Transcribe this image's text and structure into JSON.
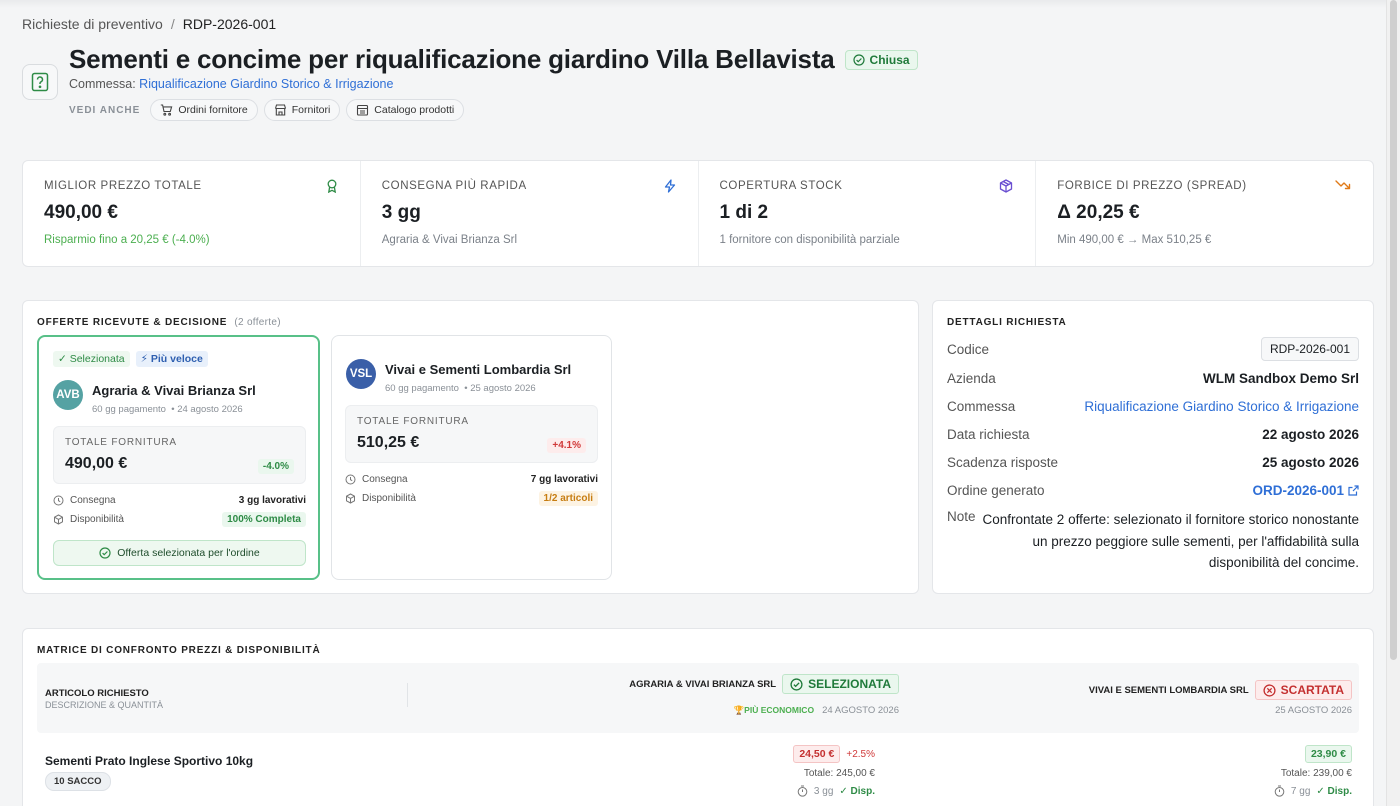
{
  "breadcrumb": {
    "parent": "Richieste di preventivo",
    "separator": "/",
    "current": "RDP-2026-001"
  },
  "header": {
    "title": "Sementi e concime per riqualificazione giardino Villa Bellavista",
    "status": "Chiusa",
    "commessa_label": "Commessa:",
    "commessa_value": "Riqualificazione Giardino Storico & Irrigazione",
    "see_also_label": "VEDI ANCHE",
    "links": [
      "Ordini fornitore",
      "Fornitori",
      "Catalogo prodotti"
    ]
  },
  "kpis": [
    {
      "label": "MIGLIOR PREZZO TOTALE",
      "value": "490,00 €",
      "sub": "Risparmio fino a 20,25 € (-4.0%)",
      "icon": "award-icon"
    },
    {
      "label": "CONSEGNA PIÙ RAPIDA",
      "value": "3 gg",
      "sub": "Agraria & Vivai Brianza Srl",
      "icon": "zap-icon"
    },
    {
      "label": "COPERTURA STOCK",
      "value": "1 di 2",
      "sub": "1 fornitore con disponibilità parziale",
      "icon": "package-icon"
    },
    {
      "label": "FORBICE DI PREZZO (SPREAD)",
      "value": "Δ 20,25 €",
      "sub": "Min 490,00 € → Max 510,25 €",
      "icon": "trending-down-icon"
    }
  ],
  "offers": {
    "title": "OFFERTE RICEVUTE & DECISIONE",
    "count": "(2 offerte)",
    "selected": {
      "tag_selected": "✓ Selezionata",
      "tag_fast": "⚡ Più veloce",
      "initials": "AVB",
      "name": "Agraria & Vivai Brianza Srl",
      "payment": "60 gg pagamento",
      "date": "• 24 agosto 2026",
      "total_label": "TOTALE FORNITURA",
      "total": "490,00 €",
      "delta": "-4.0%",
      "delivery_label": "Consegna",
      "delivery": "3 gg lavorativi",
      "availability_label": "Disponibilità",
      "availability": "100% Completa",
      "button": "Offerta selezionata per l'ordine"
    },
    "other": {
      "initials": "VSL",
      "name": "Vivai e Sementi Lombardia Srl",
      "payment": "60 gg pagamento",
      "date": "• 25 agosto 2026",
      "total_label": "TOTALE FORNITURA",
      "total": "510,25 €",
      "delta": "+4.1%",
      "delivery_label": "Consegna",
      "delivery": "7 gg lavorativi",
      "availability_label": "Disponibilità",
      "availability": "1/2 articoli"
    }
  },
  "details": {
    "title": "DETTAGLI RICHIESTA",
    "rows": {
      "codice_l": "Codice",
      "codice_v": "RDP-2026-001",
      "azienda_l": "Azienda",
      "azienda_v": "WLM Sandbox Demo Srl",
      "commessa_l": "Commessa",
      "commessa_v": "Riqualificazione Giardino Storico & Irrigazione",
      "data_l": "Data richiesta",
      "data_v": "22 agosto 2026",
      "scad_l": "Scadenza risposte",
      "scad_v": "25 agosto 2026",
      "ordine_l": "Ordine generato",
      "ordine_v": "ORD-2026-001",
      "note_l": "Note",
      "note_v": "Confrontate 2 offerte: selezionato il fornitore storico nonostante un prezzo peggiore sulle sementi, per l'affidabilità sulla disponibilità del concime."
    }
  },
  "matrix": {
    "title": "MATRICE DI CONFRONTO PREZZI & DISPONIBILITÀ",
    "col_item": "ARTICOLO RICHIESTO",
    "col_item_sub": "DESCRIZIONE & QUANTITÀ",
    "sup1": {
      "name": "AGRARIA & VIVAI BRIANZA SRL",
      "badge": "SELEZIONATA",
      "eco": "🏆PIÙ ECONOMICO",
      "date": "24 AGOSTO 2026"
    },
    "sup2": {
      "name": "VIVAI E SEMENTI LOMBARDIA SRL",
      "badge": "SCARTATA",
      "date": "25 AGOSTO 2026"
    },
    "rows": [
      {
        "name": "Sementi Prato Inglese Sportivo 10kg",
        "qty": "10 SACCO",
        "p1": "24,50 €",
        "p1_delta": "+2.5%",
        "p1_total": "Totale: 245,00 €",
        "p1_days": "3 gg",
        "p1_disp": "✓ Disp.",
        "p2": "23,90 €",
        "p2_total": "Totale: 239,00 €",
        "p2_days": "7 gg",
        "p2_disp": "✓ Disp."
      }
    ]
  },
  "colors": {
    "accent": "#2f6fd6",
    "success": "#58c088",
    "danger": "#d03a3a",
    "warning": "#c77d12"
  }
}
